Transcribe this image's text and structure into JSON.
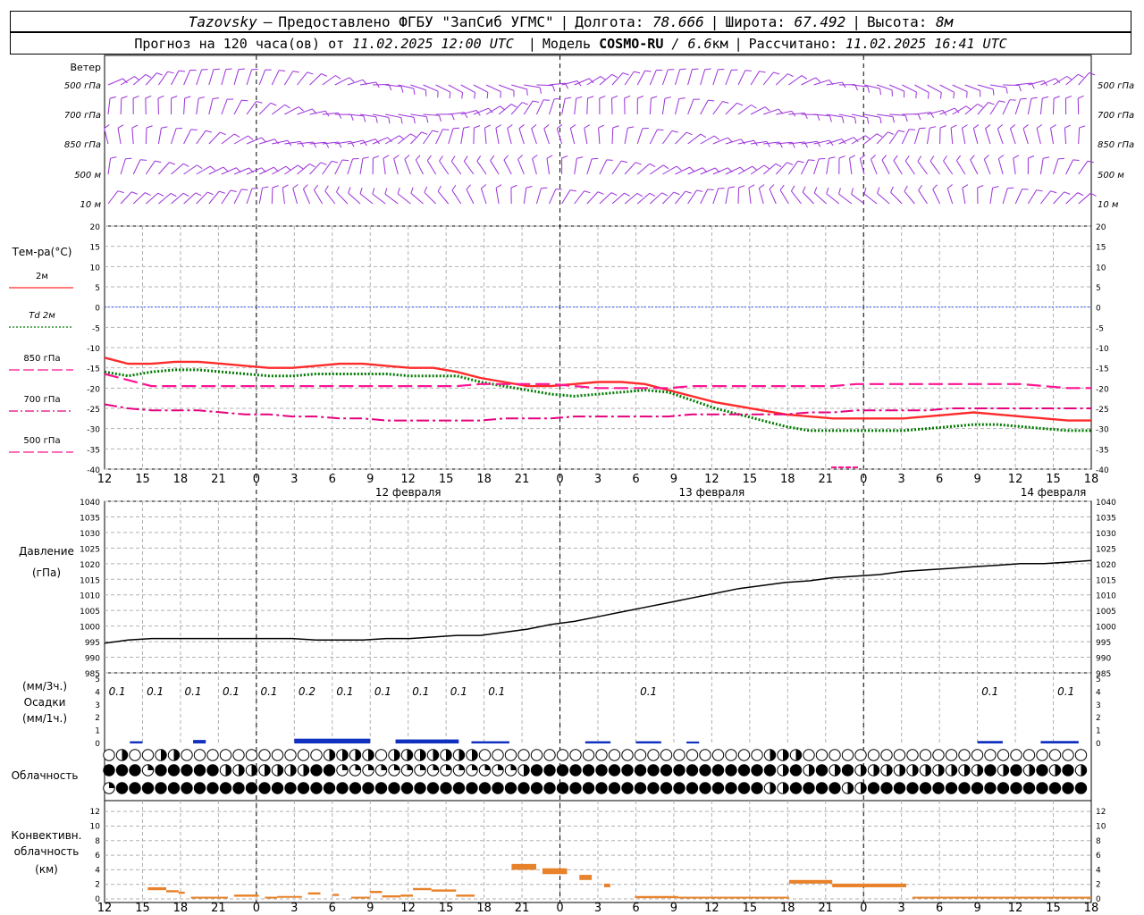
{
  "header": {
    "station": "Tazovsky",
    "dash": "–",
    "provider": "Предоставлено ФГБУ \"ЗапСиб УГМС\"",
    "lon_label": "Долгота:",
    "lon_value": "78.666",
    "lat_label": "Широта:",
    "lat_value": "67.492",
    "alt_label": "Высота:",
    "alt_value": "8м",
    "forecast_label": "Прогноз на 120 часа(ов) от",
    "forecast_time": "11.02.2025 12:00 UTC",
    "model_label": "Модель",
    "model_name": "COSMO-RU",
    "model_slash": "/",
    "model_res": "6.6",
    "model_unit": "км",
    "computed_label": "Рассчитано:",
    "computed_time": "11.02.2025 16:41 UTC"
  },
  "colors": {
    "wind": "#9b30d9",
    "t2m": "#ff2a2a",
    "td2m": "#007a00",
    "t850": "#ff1493",
    "t700": "#e6007e",
    "t500": "#ff1493",
    "zero_line": "#3a5fff",
    "pressure": "#000000",
    "precip": "#1030c0",
    "convective": "#e8822a",
    "grid": "#b0b0b0"
  },
  "time_axis": {
    "hour_ticks": [
      "12",
      "15",
      "18",
      "21",
      "0",
      "3",
      "6",
      "9",
      "12",
      "15",
      "18",
      "21",
      "0",
      "3",
      "6",
      "9",
      "12",
      "15",
      "18",
      "21",
      "0",
      "3",
      "6",
      "9",
      "12",
      "15",
      "18"
    ],
    "days": [
      {
        "label": "12 февраля",
        "hour_index": 7.5
      },
      {
        "label": "13 февраля",
        "hour_index": 15.5
      },
      {
        "label": "14 февраля",
        "hour_index": 24.5
      }
    ]
  },
  "wind_panel": {
    "title": "Ветер",
    "levels": [
      "500 гПа",
      "700 гПа",
      "850 гПа",
      "500 м",
      "10 м"
    ]
  },
  "chart_data": [
    {
      "type": "line",
      "name": "temperature",
      "title": "Тем-ра(°C)",
      "ylim": [
        -40,
        20
      ],
      "ytick_labels": [
        "20",
        "15",
        "10",
        "5",
        "0",
        "-5",
        "-10",
        "-15",
        "-20",
        "-25",
        "-30",
        "-35",
        "-40"
      ],
      "legend": [
        {
          "name": "2м",
          "style": "solid",
          "color": "#ff2a2a"
        },
        {
          "name": "Td 2м",
          "style": "dotted",
          "color": "#007a00"
        },
        {
          "name": "850 гПа",
          "style": "dash",
          "color": "#ff1493"
        },
        {
          "name": "700 гПа",
          "style": "dashdot",
          "color": "#e6007e"
        },
        {
          "name": "500 гПа",
          "style": "dash",
          "color": "#ff1493"
        }
      ],
      "x_hours": [
        0,
        3,
        6,
        9,
        12,
        15,
        18,
        21,
        24,
        27,
        30,
        33,
        36,
        39,
        42,
        45,
        48,
        51,
        54,
        57,
        60,
        63,
        66,
        69,
        72,
        75,
        78,
        81,
        84,
        87,
        90,
        93,
        96,
        99,
        102,
        105,
        108,
        111,
        114,
        117,
        120,
        123,
        126,
        129,
        132,
        135,
        138,
        141,
        144,
        147,
        150,
        153,
        156,
        159,
        162,
        165,
        168,
        171,
        174,
        177,
        180
      ],
      "series": [
        {
          "name": "2м",
          "values": [
            -12.5,
            -14,
            -14,
            -13.5,
            -13.5,
            -14,
            -14.5,
            -15,
            -15,
            -14.5,
            -14,
            -14,
            -14.5,
            -15,
            -15,
            -16,
            -17.5,
            -18.5,
            -19.5,
            -19.5,
            -19,
            -18.5,
            -18.5,
            -19,
            -20.5,
            -22,
            -23.5,
            -24.5,
            -25.5,
            -26.5,
            -27,
            -27.5,
            -27.5,
            -27.5,
            -27.5,
            -27,
            -26.5,
            -26,
            -26.5,
            -27,
            -27.5,
            -28,
            -28
          ]
        },
        {
          "name": "Td 2м",
          "values": [
            -16,
            -17,
            -16,
            -15.5,
            -15.5,
            -16,
            -16.5,
            -17,
            -17,
            -16.5,
            -16.5,
            -16.5,
            -16.5,
            -17,
            -17,
            -17,
            -18.5,
            -19.5,
            -20.5,
            -21.5,
            -22,
            -21.5,
            -21,
            -20.5,
            -21,
            -23,
            -25,
            -26.5,
            -28,
            -29.5,
            -30.5,
            -30.5,
            -30.5,
            -30.5,
            -30.5,
            -30,
            -29.5,
            -29,
            -29,
            -29.5,
            -30,
            -30.5,
            -30.5
          ]
        },
        {
          "name": "850 гПа",
          "values": [
            -16.5,
            -18,
            -19.5,
            -19.5,
            -19.5,
            -19.5,
            -19.5,
            -19.5,
            -19.5,
            -19.5,
            -19.5,
            -19.5,
            -19.5,
            -19.5,
            -19.5,
            -19.5,
            -19,
            -19,
            -19,
            -19,
            -19.5,
            -20,
            -20,
            -20,
            -20,
            -19.5,
            -19.5,
            -19.5,
            -19.5,
            -19.5,
            -19.5,
            -19.5,
            -19,
            -19,
            -19,
            -19,
            -19,
            -19,
            -19,
            -19,
            -19.5,
            -20,
            -20
          ]
        },
        {
          "name": "700 гПа",
          "values": [
            -24,
            -25,
            -25.5,
            -25.5,
            -25.5,
            -26,
            -26.5,
            -26.5,
            -27,
            -27,
            -27.5,
            -27.5,
            -28,
            -28,
            -28,
            -28,
            -28,
            -27.5,
            -27.5,
            -27.5,
            -27,
            -27,
            -27,
            -27,
            -27,
            -26.5,
            -26.5,
            -26.5,
            -26.5,
            -26.5,
            -26,
            -26,
            -25.5,
            -25.5,
            -25.5,
            -25.5,
            -25,
            -25,
            -25,
            -25,
            -25,
            -25,
            -25
          ]
        },
        {
          "name": "500 гПа",
          "values": []
        }
      ]
    },
    {
      "type": "line",
      "name": "pressure",
      "title": "Давление",
      "unit": "(гПа)",
      "ylim": [
        985,
        1040
      ],
      "ytick_labels": [
        "1040",
        "1035",
        "1030",
        "1025",
        "1020",
        "1015",
        "1010",
        "1005",
        "1000",
        "995",
        "990",
        "985"
      ],
      "values": [
        994.5,
        995.5,
        996,
        996,
        996,
        996,
        996,
        996,
        996,
        995.5,
        995.5,
        995.5,
        996,
        996,
        996.5,
        997,
        997,
        998,
        999,
        1000.5,
        1001.5,
        1003,
        1004.5,
        1006,
        1007.5,
        1009,
        1010.5,
        1012,
        1013,
        1014,
        1014.5,
        1015.5,
        1016,
        1016.5,
        1017.5,
        1018,
        1018.5,
        1019,
        1019.5,
        1020,
        1020,
        1020.5,
        1021
      ]
    },
    {
      "type": "bar",
      "name": "precipitation",
      "unit_3h": "(мм/3ч.)",
      "title": "Осадки",
      "unit_1h": "(мм/1ч.)",
      "ylim": [
        0,
        5
      ],
      "ytick_labels": [
        "5",
        "4",
        "3",
        "2",
        "1",
        "0"
      ],
      "labels_3h": [
        {
          "hour": 1,
          "text": "0.1"
        },
        {
          "hour": 4,
          "text": "0.1"
        },
        {
          "hour": 7,
          "text": "0.1"
        },
        {
          "hour": 10,
          "text": "0.1"
        },
        {
          "hour": 13,
          "text": "0.1"
        },
        {
          "hour": 16,
          "text": "0.2"
        },
        {
          "hour": 19,
          "text": "0.1"
        },
        {
          "hour": 22,
          "text": "0.1"
        },
        {
          "hour": 25,
          "text": "0.1"
        },
        {
          "hour": 28,
          "text": "0.1"
        },
        {
          "hour": 31,
          "text": "0.1"
        },
        {
          "hour": 43,
          "text": "0.1"
        },
        {
          "hour": 70,
          "text": "0.1"
        },
        {
          "hour": 76,
          "text": "0.1"
        }
      ],
      "segments": [
        {
          "from": 2,
          "to": 3,
          "value": 0.05
        },
        {
          "from": 7,
          "to": 8,
          "value": 0.1
        },
        {
          "from": 15,
          "to": 21,
          "value": 0.15
        },
        {
          "from": 23,
          "to": 28,
          "value": 0.12
        },
        {
          "from": 29,
          "to": 32,
          "value": 0.05
        },
        {
          "from": 38,
          "to": 40,
          "value": 0.05
        },
        {
          "from": 42,
          "to": 44,
          "value": 0.05
        },
        {
          "from": 46,
          "to": 47,
          "value": 0.04
        },
        {
          "from": 69,
          "to": 71,
          "value": 0.06
        },
        {
          "from": 74,
          "to": 77,
          "value": 0.06
        }
      ]
    },
    {
      "type": "table",
      "name": "cloud_cover",
      "title": "Облачность",
      "rows": [
        "0100110000000000011110111111100000000000000000000001110000000000000000000000",
        "4442444443333333442222222222222234444444444444444444343434333333333343434343",
        "2444444444444444444444444444444444444444444444444441144441144444444444444444"
      ]
    },
    {
      "type": "bar",
      "name": "convective",
      "title": "Конвективн.",
      "subtitle": "облачность",
      "unit": "(км)",
      "ylim": [
        0,
        13
      ],
      "ytick_labels": [
        "12",
        "10",
        "8",
        "6",
        "4",
        "2",
        "0"
      ],
      "segments": [
        {
          "from": 7,
          "to": 10,
          "bottom": 1.2,
          "top": 1.6
        },
        {
          "from": 10,
          "to": 12,
          "bottom": 0.9,
          "top": 1.2
        },
        {
          "from": 12,
          "to": 13,
          "bottom": 0.7,
          "top": 1.0
        },
        {
          "from": 14,
          "to": 20,
          "bottom": 0.1,
          "top": 0.3
        },
        {
          "from": 21,
          "to": 25,
          "bottom": 0.3,
          "top": 0.6
        },
        {
          "from": 26,
          "to": 28,
          "bottom": 0.1,
          "top": 0.3
        },
        {
          "from": 28,
          "to": 32,
          "bottom": 0.2,
          "top": 0.4
        },
        {
          "from": 33,
          "to": 35,
          "bottom": 0.6,
          "top": 0.9
        },
        {
          "from": 37,
          "to": 38,
          "bottom": 0.4,
          "top": 0.7
        },
        {
          "from": 40,
          "to": 43,
          "bottom": 0.1,
          "top": 0.3
        },
        {
          "from": 43,
          "to": 45,
          "bottom": 0.8,
          "top": 1.1
        },
        {
          "from": 45,
          "to": 48,
          "bottom": 0.2,
          "top": 0.5
        },
        {
          "from": 48,
          "to": 50,
          "bottom": 0.3,
          "top": 0.6
        },
        {
          "from": 50,
          "to": 53,
          "bottom": 1.2,
          "top": 1.5
        },
        {
          "from": 53,
          "to": 57,
          "bottom": 1.0,
          "top": 1.3
        },
        {
          "from": 57,
          "to": 60,
          "bottom": 0.3,
          "top": 0.6
        },
        {
          "from": 66,
          "to": 70,
          "bottom": 4.0,
          "top": 4.8
        },
        {
          "from": 71,
          "to": 75,
          "bottom": 3.4,
          "top": 4.2
        },
        {
          "from": 77,
          "to": 79,
          "bottom": 2.6,
          "top": 3.3
        },
        {
          "from": 81,
          "to": 82,
          "bottom": 1.6,
          "top": 2.1
        },
        {
          "from": 86,
          "to": 93,
          "bottom": 0.1,
          "top": 0.4
        },
        {
          "from": 93,
          "to": 111,
          "bottom": 0.1,
          "top": 0.3
        },
        {
          "from": 111,
          "to": 118,
          "bottom": 2.1,
          "top": 2.6
        },
        {
          "from": 118,
          "to": 130,
          "bottom": 1.6,
          "top": 2.1
        },
        {
          "from": 131,
          "to": 140,
          "bottom": 0.1,
          "top": 0.3
        },
        {
          "from": 140,
          "to": 150,
          "bottom": 0.1,
          "top": 0.3
        },
        {
          "from": 150,
          "to": 160,
          "bottom": 0.1,
          "top": 0.3
        }
      ]
    }
  ]
}
